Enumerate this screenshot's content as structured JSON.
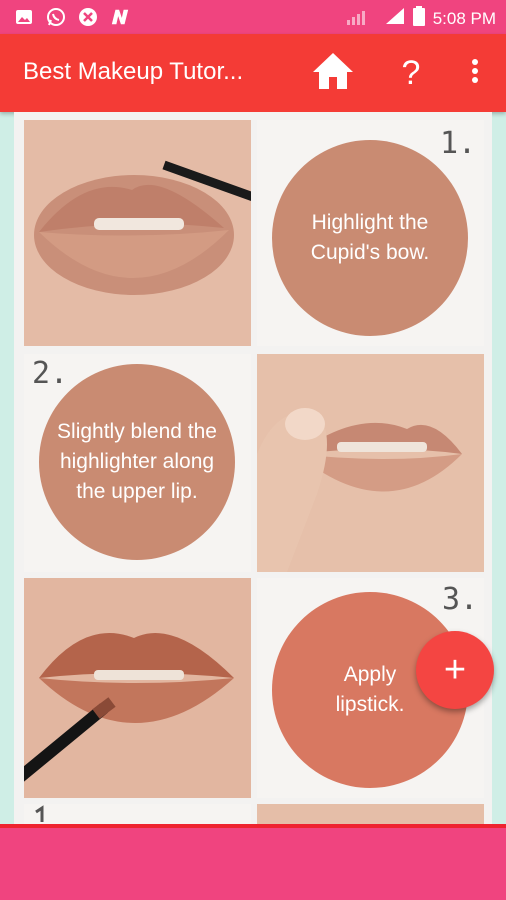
{
  "status_bar": {
    "time": "5:08 PM",
    "notification_icons": [
      "image-icon",
      "whatsapp-icon",
      "app-icon",
      "n-icon"
    ]
  },
  "app_bar": {
    "title": "Best Makeup Tutor...",
    "icons": [
      "home-icon",
      "help-icon",
      "overflow-menu-icon"
    ],
    "help_label": "?"
  },
  "steps": [
    {
      "number": "1.",
      "text": "Highlight the Cupid's bow."
    },
    {
      "number": "2.",
      "text": "Slightly blend the highlighter along the upper lip."
    },
    {
      "number": "3.",
      "text": "Apply lipstick."
    }
  ],
  "fab": {
    "label": "+"
  },
  "colors": {
    "status_bar": "#f0447f",
    "app_bar": "#f43b36",
    "circle": "#c98b72",
    "fab": "#f44542"
  }
}
